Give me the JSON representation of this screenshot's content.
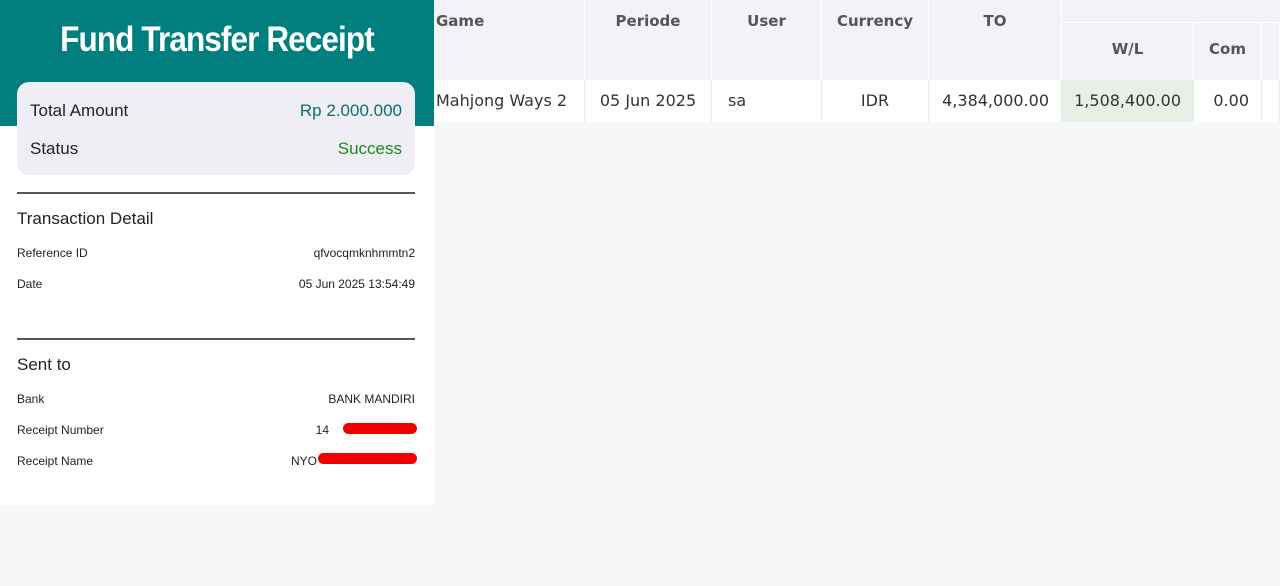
{
  "receipt": {
    "title": "Fund Transfer Receipt",
    "summary": {
      "amount_label": "Total Amount",
      "amount_value": "Rp 2.000.000",
      "status_label": "Status",
      "status_value": "Success"
    },
    "transaction_detail": {
      "title": "Transaction Detail",
      "reference_label": "Reference ID",
      "reference_value": "qfvocqmknhmmtn2",
      "date_label": "Date",
      "date_value": "05 Jun 2025 13:54:49"
    },
    "sent_to": {
      "title": "Sent to",
      "bank_label": "Bank",
      "bank_value": "BANK MANDIRI",
      "receipt_number_label": "Receipt Number",
      "receipt_number_value": "14",
      "receipt_name_label": "Receipt Name",
      "receipt_name_value": "NYO"
    }
  },
  "report_table": {
    "headers": {
      "game": "Game",
      "periode": "Periode",
      "user": "User",
      "currency": "Currency",
      "to": "TO",
      "wl": "W/L",
      "com": "Com"
    },
    "row": {
      "game": "Mahjong Ways 2",
      "periode": "05 Jun 2025",
      "user": "sa",
      "currency": "IDR",
      "to": "4,384,000.00",
      "wl": "1,508,400.00",
      "com": "0.00"
    }
  },
  "colors": {
    "header_teal": "#017f7e",
    "success_green": "#1a8a1a",
    "amount_teal": "#0b6e6a",
    "redaction_red": "#f20000",
    "wl_highlight": "#e8efe6"
  }
}
